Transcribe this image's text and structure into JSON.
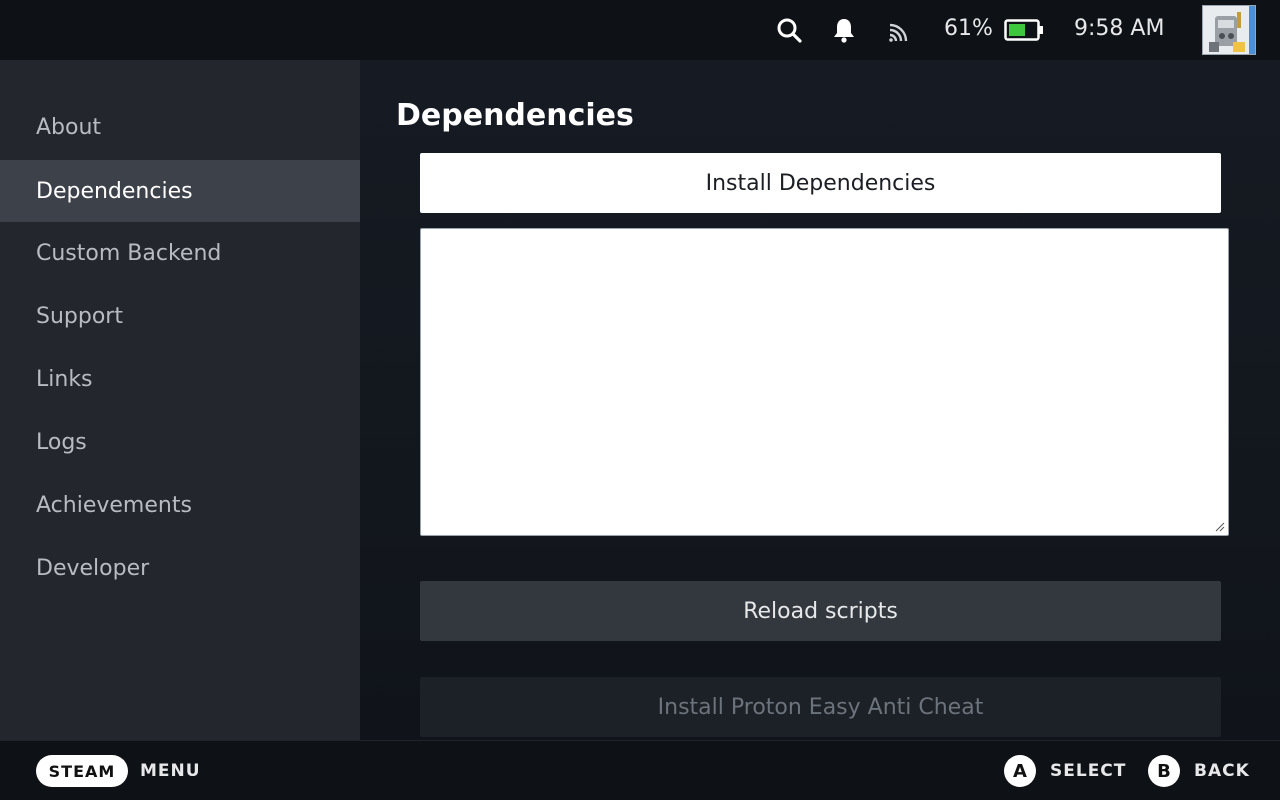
{
  "status_bar": {
    "battery_percent": "61%",
    "battery_level": 0.61,
    "time": "9:58 AM",
    "icons": [
      "search-icon",
      "bell-icon",
      "cast-icon",
      "battery-icon"
    ]
  },
  "sidebar": {
    "items": [
      {
        "label": "About",
        "active": false
      },
      {
        "label": "Dependencies",
        "active": true
      },
      {
        "label": "Custom Backend",
        "active": false
      },
      {
        "label": "Support",
        "active": false
      },
      {
        "label": "Links",
        "active": false
      },
      {
        "label": "Logs",
        "active": false
      },
      {
        "label": "Achievements",
        "active": false
      },
      {
        "label": "Developer",
        "active": false
      }
    ]
  },
  "main": {
    "title": "Dependencies",
    "install_button": "Install Dependencies",
    "log_output": "",
    "reload_button": "Reload scripts",
    "proton_button": "Install Proton Easy Anti Cheat"
  },
  "bottom_bar": {
    "steam_label": "STEAM",
    "menu_label": "MENU",
    "a_glyph": "A",
    "select_label": "SELECT",
    "b_glyph": "B",
    "back_label": "BACK"
  },
  "colors": {
    "battery_fill": "#3fc63f",
    "active_item_bg": "#3d4149",
    "sidebar_bg": "#23262d"
  }
}
